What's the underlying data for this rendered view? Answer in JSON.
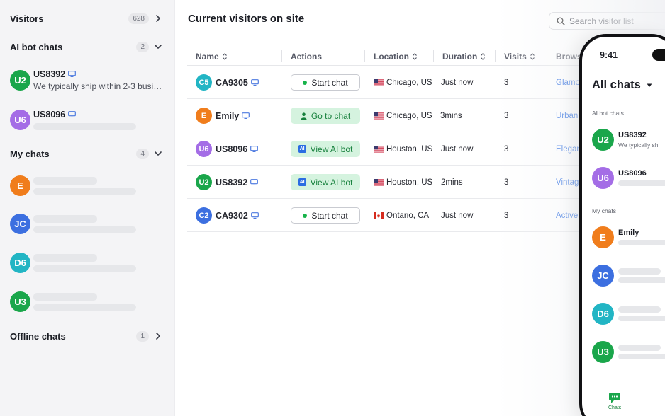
{
  "sidebar": {
    "sections": {
      "visitors": {
        "title": "Visitors",
        "count": "628"
      },
      "ai_bot_chats": {
        "title": "AI bot chats",
        "count": "2"
      },
      "my_chats": {
        "title": "My chats",
        "count": "4"
      },
      "offline_chats": {
        "title": "Offline chats",
        "count": "1"
      }
    },
    "ai_chats": [
      {
        "initials": "U2",
        "name": "US8392",
        "preview": "We typically ship within 2-3 business days",
        "color": "#1aa64b"
      },
      {
        "initials": "U6",
        "name": "US8096",
        "color": "#a46de6"
      }
    ],
    "my_chats": [
      {
        "initials": "E",
        "color": "#f07d1c"
      },
      {
        "initials": "JC",
        "color": "#3c6fe0"
      },
      {
        "initials": "D6",
        "color": "#22b5c4"
      },
      {
        "initials": "U3",
        "color": "#1aa64b"
      }
    ]
  },
  "main": {
    "title": "Current visitors on site",
    "search_placeholder": "Search visitor list",
    "columns": [
      "Name",
      "Actions",
      "Location",
      "Duration",
      "Visits",
      "Browsi"
    ],
    "rows": [
      {
        "initials": "C5",
        "color": "#22b5c4",
        "name": "CA9305",
        "monitor": true,
        "action": "Start chat",
        "action_style": "outline",
        "flag": "us",
        "location": "Chicago, US",
        "duration": "Just now",
        "visits": "3",
        "browser": "Glamou"
      },
      {
        "initials": "E",
        "color": "#f07d1c",
        "name": "Emily",
        "monitor": true,
        "action": "Go to chat",
        "action_style": "green-person",
        "flag": "us",
        "location": "Chicago, US",
        "duration": "3mins",
        "visits": "3",
        "browser": "Urban"
      },
      {
        "initials": "U6",
        "color": "#a46de6",
        "name": "US8096",
        "monitor": true,
        "action": "View AI bot",
        "action_style": "green-ai",
        "flag": "us",
        "location": "Houston, US",
        "duration": "Just now",
        "visits": "3",
        "browser": "Elegan"
      },
      {
        "initials": "U2",
        "color": "#1aa64b",
        "name": "US8392",
        "monitor": true,
        "action": "View AI bot",
        "action_style": "green-ai",
        "flag": "us",
        "location": "Houston, US",
        "duration": "2mins",
        "visits": "3",
        "browser": "Vintag"
      },
      {
        "initials": "C2",
        "color": "#3c6fe0",
        "name": "CA9302",
        "monitor": true,
        "action": "Start chat",
        "action_style": "outline",
        "flag": "ca",
        "location": "Ontario, CA",
        "duration": "Just now",
        "visits": "3",
        "browser": "Active"
      }
    ]
  },
  "phone": {
    "time": "9:41",
    "title": "All chats",
    "ai_section": "AI bot chats",
    "my_section": "My chats",
    "ai_chats": [
      {
        "initials": "U2",
        "name": "US8392",
        "preview": "We typically shi",
        "color": "#1aa64b"
      },
      {
        "initials": "U6",
        "name": "US8096",
        "color": "#a46de6"
      }
    ],
    "my_chats": [
      {
        "initials": "E",
        "name": "Emily",
        "color": "#f07d1c"
      },
      {
        "initials": "JC",
        "color": "#3c6fe0"
      },
      {
        "initials": "D6",
        "color": "#22b5c4"
      },
      {
        "initials": "U3",
        "color": "#1aa64b"
      }
    ],
    "tab_label": "Chats"
  },
  "icons": {
    "search": "search-icon",
    "monitor": "monitor-icon",
    "chevron": "chevron-icon",
    "sort": "sort-icon",
    "person": "person-icon",
    "ai": "ai-icon",
    "chat": "chat-bubble-icon"
  },
  "colors": {
    "accent_green": "#16803c",
    "link_blue": "#2b6de2",
    "ai_badge": "#2b6de2"
  },
  "ai_badge_text": "AI"
}
